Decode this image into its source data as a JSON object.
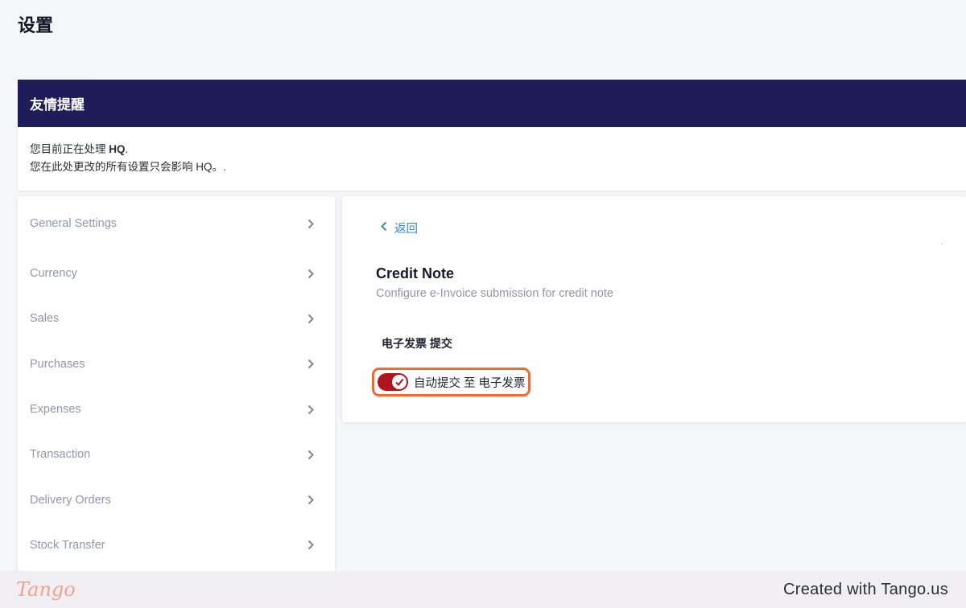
{
  "page": {
    "title": "设置"
  },
  "notice": {
    "heading": "友情提醒",
    "line1_prefix": "您目前正在处理 ",
    "line1_entity": "HQ",
    "line1_suffix": ".",
    "line2": "您在此处更改的所有设置只会影响 HQ。."
  },
  "sidebar": {
    "items": [
      {
        "label": "General Settings"
      },
      {
        "label": "Currency"
      },
      {
        "label": "Sales"
      },
      {
        "label": "Purchases"
      },
      {
        "label": "Expenses"
      },
      {
        "label": "Transaction"
      },
      {
        "label": "Delivery Orders"
      },
      {
        "label": "Stock Transfer"
      }
    ]
  },
  "panel": {
    "back_label": "返回",
    "title": "Credit Note",
    "subtitle": "Configure e-Invoice submission for credit note",
    "section_label": "电子发票 提交",
    "toggle": {
      "label": "自动提交 至 电子发票",
      "checked": true,
      "color": "#b0141c"
    }
  },
  "footer": {
    "logo": "Tango",
    "credit": "Created with Tango.us"
  },
  "colors": {
    "notice_header": "#1f1d59",
    "accent_blue": "#3a86c8",
    "highlight": "#f16a2e"
  }
}
